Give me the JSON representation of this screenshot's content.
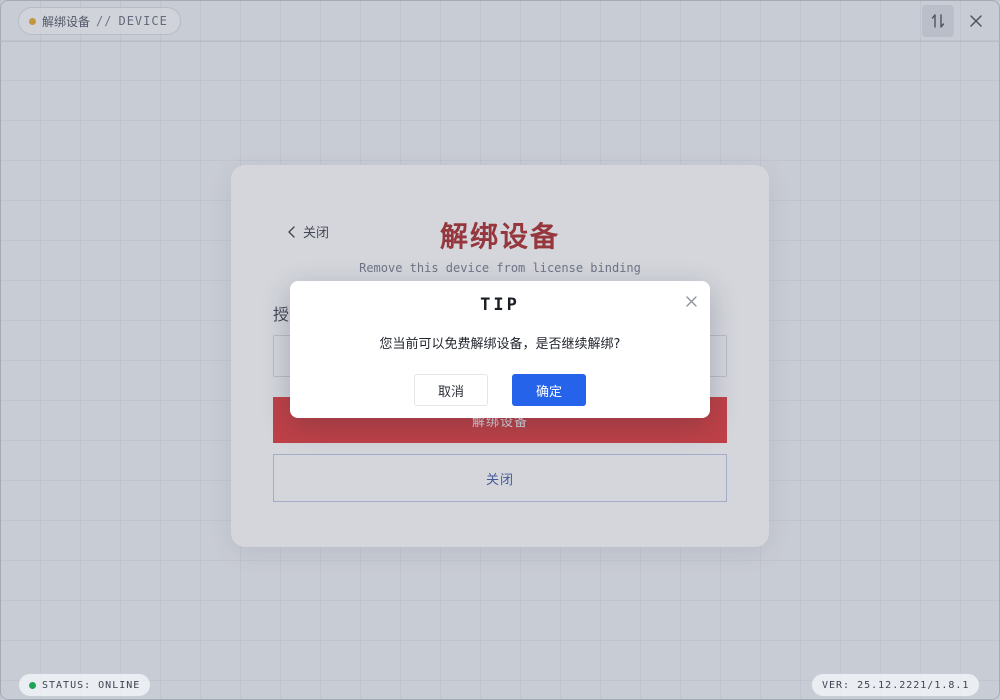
{
  "titlebar": {
    "title": "解绑设备",
    "separator": "//",
    "device": "DEVICE",
    "indicator_color": "#e8a317",
    "pin_icon": "pin-icon",
    "close_icon": "close-icon"
  },
  "card": {
    "back_label": "关闭",
    "title": "解绑设备",
    "subtitle": "Remove this device from license binding",
    "label": "授",
    "unbind_label": "解绑设备",
    "close_label": "关闭",
    "accent": "#e02424"
  },
  "modal": {
    "title": "TIP",
    "message": "您当前可以免费解绑设备，是否继续解绑?",
    "cancel_label": "取消",
    "confirm_label": "确定",
    "primary_color": "#2563eb"
  },
  "footer": {
    "status": "STATUS: ONLINE",
    "status_color": "#22a35a",
    "version": "VER: 25.12.2221/1.8.1"
  }
}
